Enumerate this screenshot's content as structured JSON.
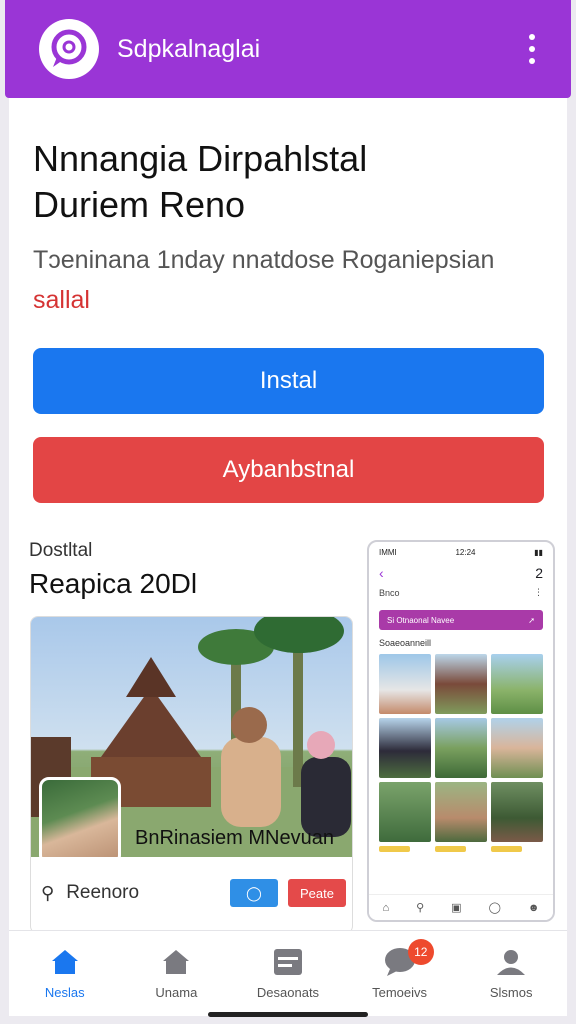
{
  "app": {
    "title": "Sdpkalnaglai",
    "logo_icon": "chat-bubble-logo",
    "accent_color": "#9a35d6"
  },
  "hero": {
    "headline_line1": "Nnnangia Dirpahlstal",
    "headline_line2": "Duriem Reno",
    "subtitle_line1": "Tɔeninana 1nday nnatdose Roganiepsian",
    "subtitle_line2": "sallal"
  },
  "buttons": {
    "primary_label": "Instal",
    "primary_color": "#1a77ef",
    "secondary_label": "Aybanbstnal",
    "secondary_color": "#e34545"
  },
  "section": {
    "label": "Dostltal",
    "title": "Reapica 20Dl"
  },
  "feature": {
    "caption": "BnRinasiem MNevuan",
    "meta_icon": "location-pin-icon",
    "meta_text": "Reenoro",
    "chip_blue_icon": "chat-icon",
    "chip_red_label": "Peate"
  },
  "phone_preview": {
    "status_time": "12:24",
    "status_left": "IMMI",
    "header_num": "2",
    "header_sub": "Bnco",
    "bar_label": "Si Otnaonal Navee",
    "grid_label": "Soaeoanneill"
  },
  "bottom_nav": [
    {
      "label": "Neslas",
      "icon": "home-icon",
      "active": true
    },
    {
      "label": "Unama",
      "icon": "store-icon",
      "active": false
    },
    {
      "label": "Desaonats",
      "icon": "list-card-icon",
      "active": false
    },
    {
      "label": "Temoeivs",
      "icon": "chat-bubble-icon",
      "active": false,
      "badge": "12"
    },
    {
      "label": "Slsmos",
      "icon": "profile-icon",
      "active": false
    }
  ]
}
